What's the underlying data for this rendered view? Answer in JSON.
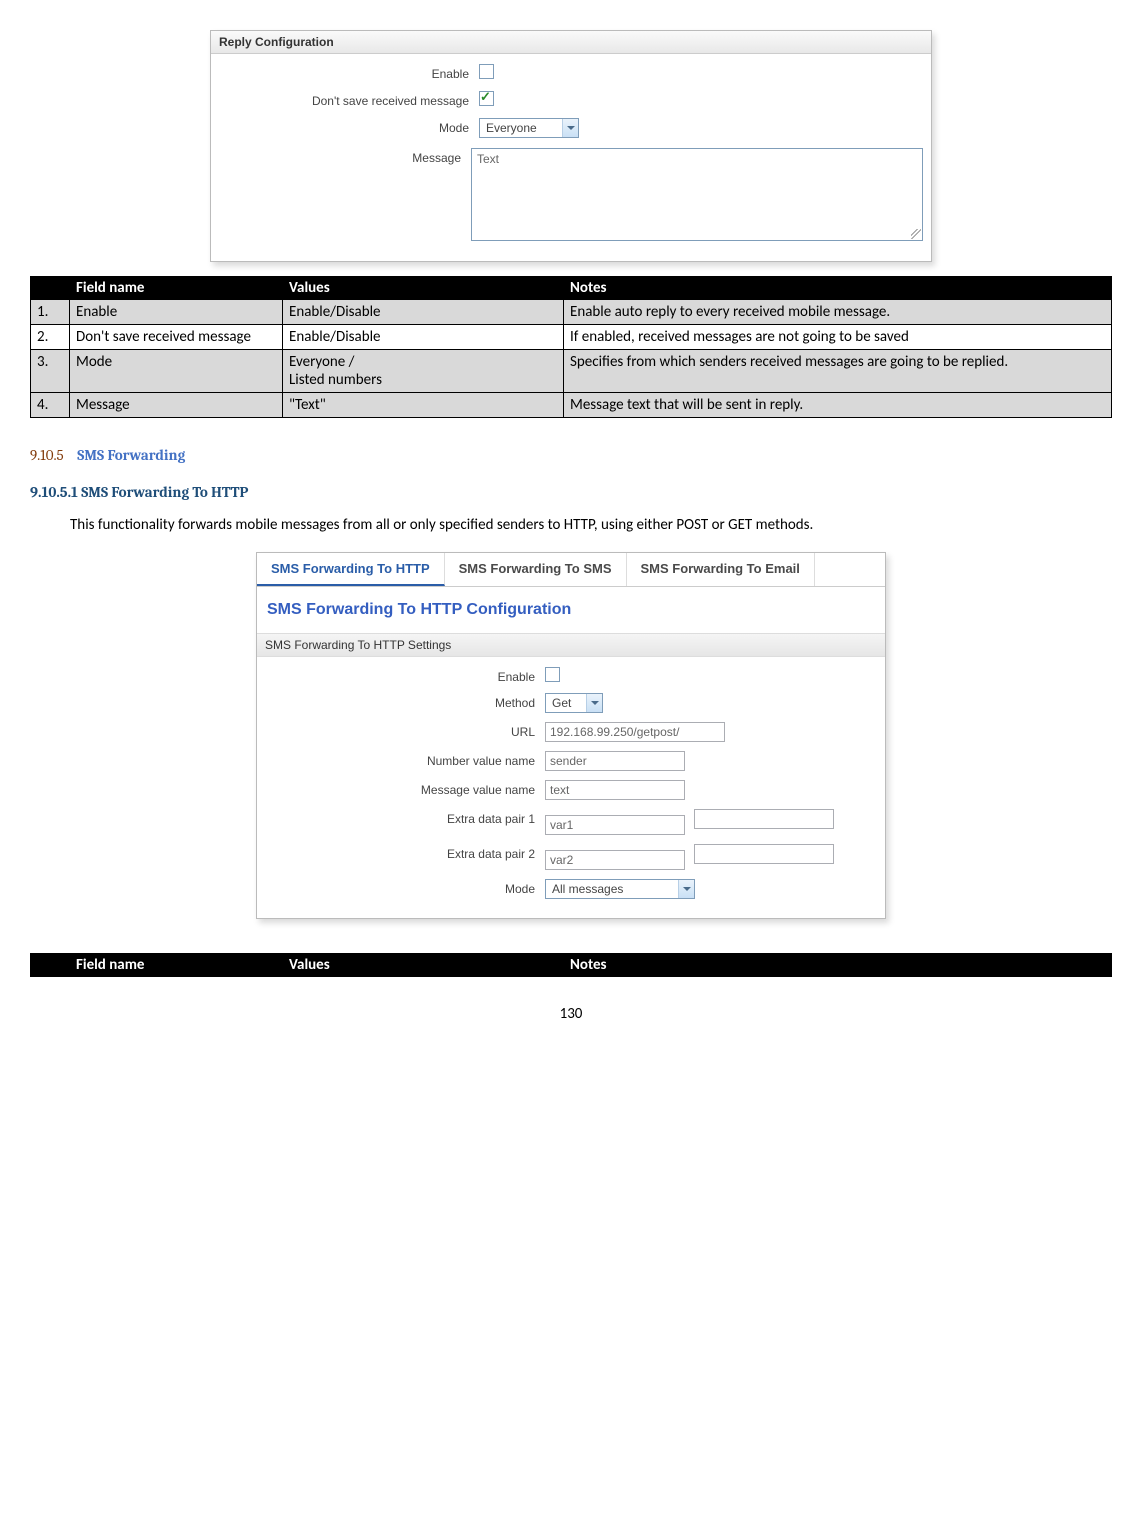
{
  "reply_panel": {
    "title": "Reply Configuration",
    "enable_label": "Enable",
    "dontsave_label": "Don't save received message",
    "mode_label": "Mode",
    "message_label": "Message",
    "mode_value": "Everyone",
    "message_value": "Text"
  },
  "table1": {
    "headers": {
      "num": "",
      "name": "Field name",
      "values": "Values",
      "notes": "Notes"
    },
    "rows": [
      {
        "num": "1.",
        "name": "Enable",
        "values": "Enable/Disable",
        "notes": "Enable auto reply to every received mobile message."
      },
      {
        "num": "2.",
        "name": "Don't save received message",
        "values": "Enable/Disable",
        "notes": "If enabled, received messages are not going to be saved"
      },
      {
        "num": "3.",
        "name": "Mode",
        "values": "Everyone /\nListed numbers",
        "notes": "Specifies from which senders received messages are going to be replied."
      },
      {
        "num": "4.",
        "name": "Message",
        "values": "\"Text\"",
        "notes": "Message text that will be sent in reply."
      }
    ]
  },
  "heading3": {
    "num": "9.10.5",
    "text": "SMS Forwarding"
  },
  "heading4": "9.10.5.1 SMS Forwarding To HTTP",
  "para1": "This functionality forwards mobile messages from all or only specified senders to HTTP, using either POST or GET methods.",
  "fwd_panel": {
    "tabs": [
      "SMS Forwarding To HTTP",
      "SMS Forwarding To SMS",
      "SMS Forwarding To Email"
    ],
    "title": "SMS Forwarding To HTTP Configuration",
    "section": "SMS Forwarding To HTTP Settings",
    "enable_label": "Enable",
    "method_label": "Method",
    "method_value": "Get",
    "url_label": "URL",
    "url_value": "192.168.99.250/getpost/",
    "numname_label": "Number value name",
    "numname_value": "sender",
    "msgname_label": "Message value name",
    "msgname_value": "text",
    "extra1_label": "Extra data pair 1",
    "extra1_value": "var1",
    "extra2_label": "Extra data pair 2",
    "extra2_value": "var2",
    "mode_label": "Mode",
    "mode_value": "All messages"
  },
  "table2": {
    "headers": {
      "num": "",
      "name": "Field name",
      "values": "Values",
      "notes": "Notes"
    }
  },
  "page_number": "130"
}
